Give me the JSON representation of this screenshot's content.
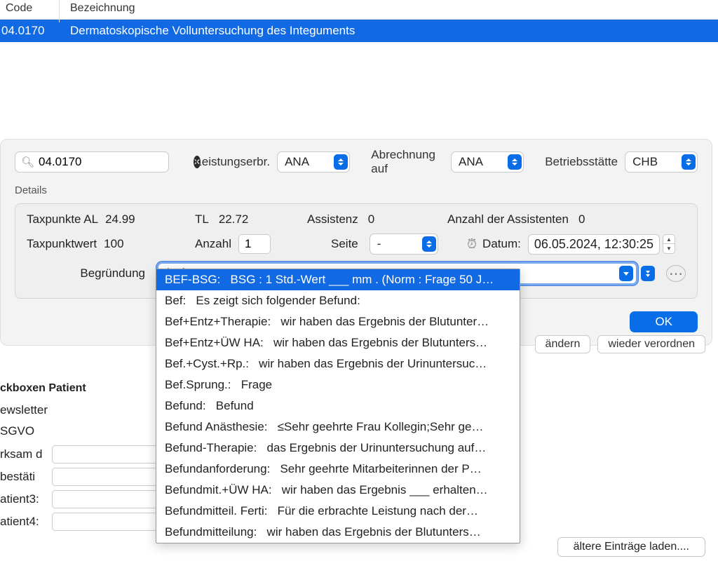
{
  "header": {
    "code": "Code",
    "bez": "Bezeichnung"
  },
  "row": {
    "code": "04.0170",
    "bez": "Dermatoskopische Volluntersuchung des Integuments"
  },
  "search": {
    "value": "04.0170"
  },
  "leistungserbr_label": "Leistungserbr.",
  "leistungserbr_value": "ANA",
  "abrechnung_label": "Abrechnung auf",
  "abrechnung_value": "ANA",
  "betriebs_label": "Betriebsstätte",
  "betriebs_value": "CHB",
  "details_label": "Details",
  "taxpunkte_al_label": "Taxpunkte  AL",
  "taxpunkte_al_value": "24.99",
  "tl_label": "TL",
  "tl_value": "22.72",
  "assistenz_label": "Assistenz",
  "assistenz_value": "0",
  "anzahl_assist_label": "Anzahl der Assistenten",
  "anzahl_assist_value": "0",
  "taxpunktwert_label": "Taxpunktwert",
  "taxpunktwert_value": "100",
  "anzahl_label": "Anzahl",
  "anzahl_value": "1",
  "seite_label": "Seite",
  "seite_value": "-",
  "datum_label": "Datum:",
  "datum_value": "06.05.2024, 12:30:25",
  "begr_label": "Begründung",
  "begr_value": "bef",
  "ok_label": "OK",
  "aendern_label": "ändern",
  "wieder_label": "wieder verordnen",
  "dropdown": [
    {
      "key": "BEF-BSG:",
      "text": "BSG : 1 Std.-Wert ___ mm . (Norm : Frage 50 J…"
    },
    {
      "key": "Bef:",
      "text": "Es zeigt sich folgender Befund:"
    },
    {
      "key": "Bef+Entz+Therapie:",
      "text": "wir haben das Ergebnis der Blutunter…"
    },
    {
      "key": "Bef+Entz+ÜW HA:",
      "text": "wir haben das Ergebnis der Blutunters…"
    },
    {
      "key": "Bef.+Cyst.+Rp.:",
      "text": "wir haben das Ergebnis der Urinuntersuc…"
    },
    {
      "key": "Bef.Sprung.:",
      "text": "Frage"
    },
    {
      "key": "Befund:",
      "text": "Befund"
    },
    {
      "key": "Befund Anästhesie:",
      "text": "≤Sehr geehrte Frau Kollegin;Sehr ge…"
    },
    {
      "key": "Befund-Therapie:",
      "text": "das Ergebnis der Urinuntersuchung auf…"
    },
    {
      "key": "Befundanforderung:",
      "text": "Sehr geehrte Mitarbeiterinnen der P…"
    },
    {
      "key": "Befundmit.+ÜW HA:",
      "text": "wir haben das Ergebnis ___ erhalten…"
    },
    {
      "key": "Befundmitteil. Ferti:",
      "text": "Für die erbrachte Leistung nach der…"
    },
    {
      "key": "Befundmitteilung:",
      "text": "wir haben das Ergebnis der Blutunters…"
    }
  ],
  "patient": {
    "title": "ckboxen Patient",
    "newsletter": "ewsletter",
    "sgvo": "SGVO",
    "wirksam": "rksam d",
    "bestat": "bestäti",
    "p3": "atient3:",
    "p4": "atient4:"
  },
  "load_label": "ältere Einträge laden...."
}
